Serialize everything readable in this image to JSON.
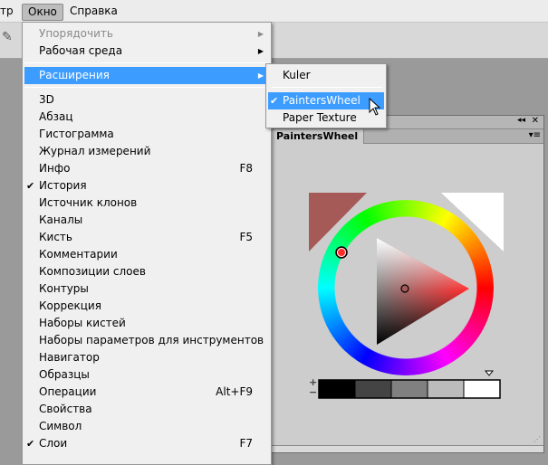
{
  "menubar": {
    "items": [
      {
        "label": "тр"
      },
      {
        "label": "Окно"
      },
      {
        "label": "Справка"
      }
    ]
  },
  "window_menu": {
    "top": [
      {
        "label": "Упорядочить",
        "disabled": true,
        "submenu": true
      },
      {
        "label": "Рабочая среда",
        "submenu": true
      }
    ],
    "extensions": {
      "label": "Расширения",
      "submenu": true
    },
    "items": [
      {
        "label": "3D"
      },
      {
        "label": "Абзац"
      },
      {
        "label": "Гистограмма"
      },
      {
        "label": "Журнал измерений"
      },
      {
        "label": "Инфо",
        "shortcut": "F8"
      },
      {
        "label": "История",
        "checked": true
      },
      {
        "label": "Источник клонов"
      },
      {
        "label": "Каналы"
      },
      {
        "label": "Кисть",
        "shortcut": "F5"
      },
      {
        "label": "Комментарии"
      },
      {
        "label": "Композиции слоев"
      },
      {
        "label": "Контуры"
      },
      {
        "label": "Коррекция"
      },
      {
        "label": "Наборы кистей"
      },
      {
        "label": "Наборы параметров для инструментов"
      },
      {
        "label": "Навигатор"
      },
      {
        "label": "Образцы"
      },
      {
        "label": "Операции",
        "shortcut": "Alt+F9"
      },
      {
        "label": "Свойства"
      },
      {
        "label": "Символ"
      },
      {
        "label": "Слои",
        "checked": true,
        "shortcut": "F7"
      }
    ]
  },
  "extensions_submenu": {
    "items": [
      {
        "label": "Kuler"
      },
      {
        "label": "PaintersWheel",
        "checked": true
      },
      {
        "label": "Paper Texture"
      }
    ]
  },
  "panel": {
    "tab": "PaintersWheel",
    "plus": "+",
    "minus": "−",
    "check": "✔",
    "foreground_color": "#a65a58",
    "background_color": "#ffffff",
    "hue_color": "#ff2a2a",
    "gray_swatches": [
      "#000000",
      "#444444",
      "#808080",
      "#bcbcbc",
      "#ffffff"
    ]
  }
}
